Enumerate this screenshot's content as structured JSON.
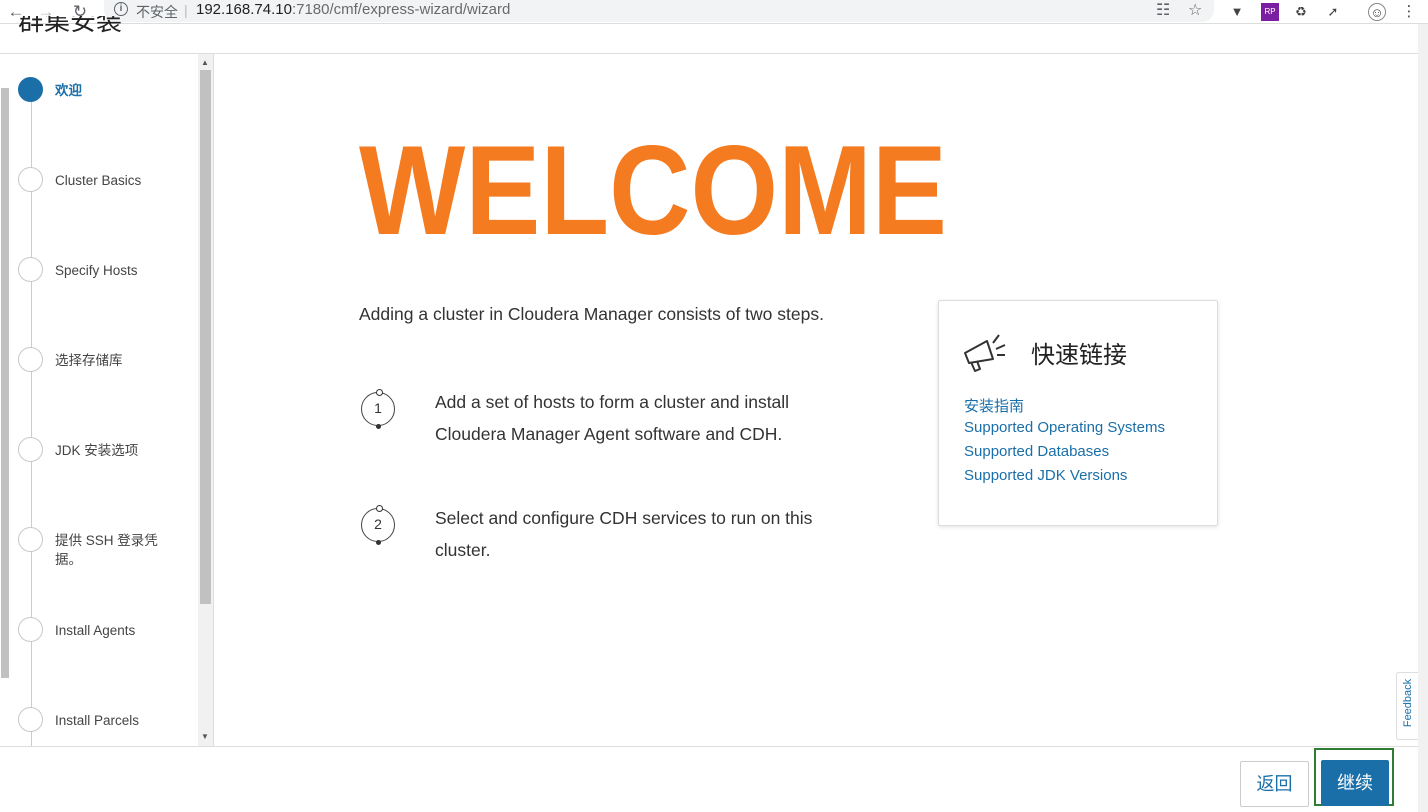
{
  "browser": {
    "security_label": "不安全",
    "url_host": "192.168.74.10",
    "url_path": ":7180/cmf/express-wizard/wizard",
    "nav_icons": [
      "back-arrow-icon",
      "forward-arrow-icon",
      "reload-icon"
    ],
    "extension_icons": [
      "translate-icon",
      "star-icon",
      "vue-devtools-icon",
      "rp-icon",
      "extension-icon",
      "chart-icon",
      "profile-icon",
      "menu-dots-icon"
    ]
  },
  "page": {
    "title": "群集安装"
  },
  "sidebar": {
    "steps": [
      {
        "label": "欢迎",
        "active": true
      },
      {
        "label": "Cluster Basics",
        "active": false
      },
      {
        "label": "Specify Hosts",
        "active": false
      },
      {
        "label": "选择存储库",
        "active": false
      },
      {
        "label": "JDK 安装选项",
        "active": false
      },
      {
        "label": "提供 SSH 登录凭据。",
        "active": false
      },
      {
        "label": "Install Agents",
        "active": false
      },
      {
        "label": "Install Parcels",
        "active": false
      }
    ]
  },
  "main": {
    "banner": "WELCOME",
    "intro": "Adding a cluster in Cloudera Manager consists of two steps.",
    "steps": [
      {
        "number": "1",
        "text": "Add a set of hosts to form a cluster and install Cloudera Manager Agent software and CDH."
      },
      {
        "number": "2",
        "text": "Select and configure CDH services to run on this cluster."
      }
    ],
    "banner_color": "#f47b20"
  },
  "quick_links": {
    "title": "快速链接",
    "links": [
      "安装指南",
      "Supported Operating Systems",
      "Supported Databases",
      "Supported JDK Versions"
    ]
  },
  "feedback": {
    "label": "Feedback"
  },
  "footer": {
    "back_label": "返回",
    "continue_label": "继续"
  },
  "colors": {
    "accent": "#1b6fa8",
    "highlight_outline": "#2e7d32"
  }
}
